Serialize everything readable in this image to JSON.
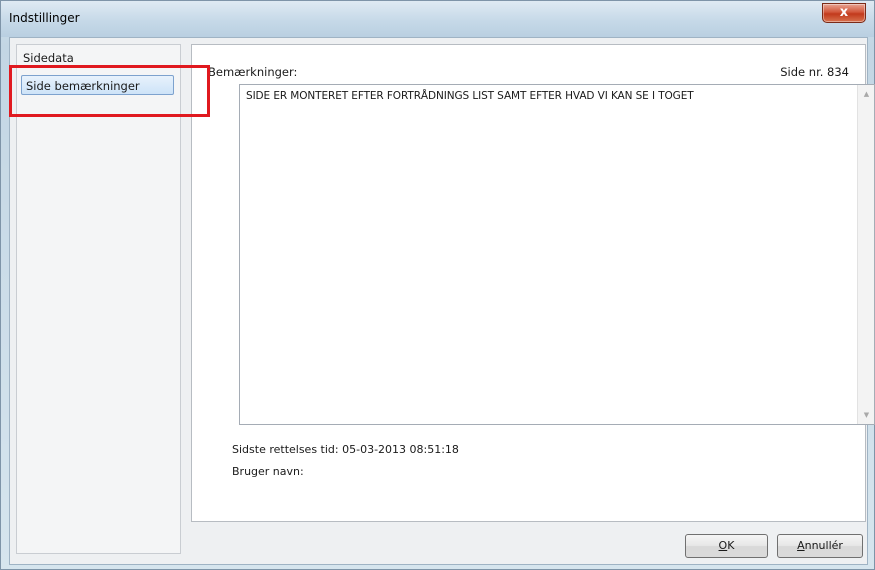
{
  "window": {
    "title": "Indstillinger",
    "close_glyph": "x"
  },
  "sidebar": {
    "items": [
      {
        "label": "Sidedata"
      },
      {
        "label": "Side bemærkninger"
      }
    ]
  },
  "main": {
    "remarks_label": "Bemærkninger:",
    "page_number": "Side nr. 834",
    "remarks_text": "SIDE ER MONTERET EFTER FORTRÅDNINGS LIST SAMT EFTER HVAD VI KAN SE I TOGET",
    "last_modified": "Sidste rettelses tid: 05-03-2013 08:51:18",
    "user_name_label": "Bruger navn:"
  },
  "buttons": {
    "ok": {
      "prefix": "",
      "mnemonic": "O",
      "suffix": "K"
    },
    "cancel": {
      "prefix": "",
      "mnemonic": "A",
      "suffix": "nnullér"
    }
  },
  "icons": {
    "scroll_up": "▲",
    "scroll_down": "▼"
  },
  "colors": {
    "annotation": "#e0191f",
    "selection": "#cde3f8",
    "close": "#c23a1c"
  }
}
